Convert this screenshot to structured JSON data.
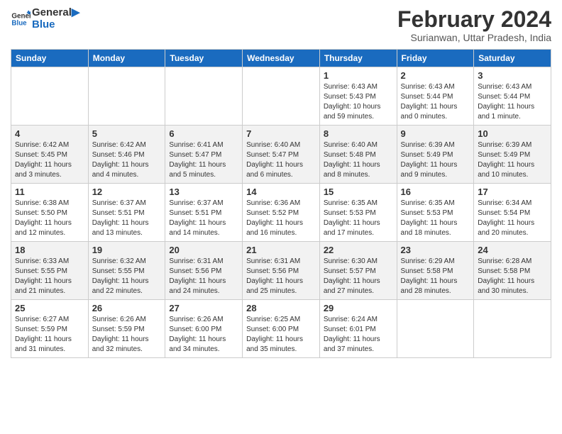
{
  "header": {
    "logo_line1": "General",
    "logo_line2": "Blue",
    "main_title": "February 2024",
    "subtitle": "Surianwan, Uttar Pradesh, India"
  },
  "columns": [
    "Sunday",
    "Monday",
    "Tuesday",
    "Wednesday",
    "Thursday",
    "Friday",
    "Saturday"
  ],
  "weeks": [
    [
      {
        "day": "",
        "info": ""
      },
      {
        "day": "",
        "info": ""
      },
      {
        "day": "",
        "info": ""
      },
      {
        "day": "",
        "info": ""
      },
      {
        "day": "1",
        "info": "Sunrise: 6:43 AM\nSunset: 5:43 PM\nDaylight: 10 hours and 59 minutes."
      },
      {
        "day": "2",
        "info": "Sunrise: 6:43 AM\nSunset: 5:44 PM\nDaylight: 11 hours and 0 minutes."
      },
      {
        "day": "3",
        "info": "Sunrise: 6:43 AM\nSunset: 5:44 PM\nDaylight: 11 hours and 1 minute."
      }
    ],
    [
      {
        "day": "4",
        "info": "Sunrise: 6:42 AM\nSunset: 5:45 PM\nDaylight: 11 hours and 3 minutes."
      },
      {
        "day": "5",
        "info": "Sunrise: 6:42 AM\nSunset: 5:46 PM\nDaylight: 11 hours and 4 minutes."
      },
      {
        "day": "6",
        "info": "Sunrise: 6:41 AM\nSunset: 5:47 PM\nDaylight: 11 hours and 5 minutes."
      },
      {
        "day": "7",
        "info": "Sunrise: 6:40 AM\nSunset: 5:47 PM\nDaylight: 11 hours and 6 minutes."
      },
      {
        "day": "8",
        "info": "Sunrise: 6:40 AM\nSunset: 5:48 PM\nDaylight: 11 hours and 8 minutes."
      },
      {
        "day": "9",
        "info": "Sunrise: 6:39 AM\nSunset: 5:49 PM\nDaylight: 11 hours and 9 minutes."
      },
      {
        "day": "10",
        "info": "Sunrise: 6:39 AM\nSunset: 5:49 PM\nDaylight: 11 hours and 10 minutes."
      }
    ],
    [
      {
        "day": "11",
        "info": "Sunrise: 6:38 AM\nSunset: 5:50 PM\nDaylight: 11 hours and 12 minutes."
      },
      {
        "day": "12",
        "info": "Sunrise: 6:37 AM\nSunset: 5:51 PM\nDaylight: 11 hours and 13 minutes."
      },
      {
        "day": "13",
        "info": "Sunrise: 6:37 AM\nSunset: 5:51 PM\nDaylight: 11 hours and 14 minutes."
      },
      {
        "day": "14",
        "info": "Sunrise: 6:36 AM\nSunset: 5:52 PM\nDaylight: 11 hours and 16 minutes."
      },
      {
        "day": "15",
        "info": "Sunrise: 6:35 AM\nSunset: 5:53 PM\nDaylight: 11 hours and 17 minutes."
      },
      {
        "day": "16",
        "info": "Sunrise: 6:35 AM\nSunset: 5:53 PM\nDaylight: 11 hours and 18 minutes."
      },
      {
        "day": "17",
        "info": "Sunrise: 6:34 AM\nSunset: 5:54 PM\nDaylight: 11 hours and 20 minutes."
      }
    ],
    [
      {
        "day": "18",
        "info": "Sunrise: 6:33 AM\nSunset: 5:55 PM\nDaylight: 11 hours and 21 minutes."
      },
      {
        "day": "19",
        "info": "Sunrise: 6:32 AM\nSunset: 5:55 PM\nDaylight: 11 hours and 22 minutes."
      },
      {
        "day": "20",
        "info": "Sunrise: 6:31 AM\nSunset: 5:56 PM\nDaylight: 11 hours and 24 minutes."
      },
      {
        "day": "21",
        "info": "Sunrise: 6:31 AM\nSunset: 5:56 PM\nDaylight: 11 hours and 25 minutes."
      },
      {
        "day": "22",
        "info": "Sunrise: 6:30 AM\nSunset: 5:57 PM\nDaylight: 11 hours and 27 minutes."
      },
      {
        "day": "23",
        "info": "Sunrise: 6:29 AM\nSunset: 5:58 PM\nDaylight: 11 hours and 28 minutes."
      },
      {
        "day": "24",
        "info": "Sunrise: 6:28 AM\nSunset: 5:58 PM\nDaylight: 11 hours and 30 minutes."
      }
    ],
    [
      {
        "day": "25",
        "info": "Sunrise: 6:27 AM\nSunset: 5:59 PM\nDaylight: 11 hours and 31 minutes."
      },
      {
        "day": "26",
        "info": "Sunrise: 6:26 AM\nSunset: 5:59 PM\nDaylight: 11 hours and 32 minutes."
      },
      {
        "day": "27",
        "info": "Sunrise: 6:26 AM\nSunset: 6:00 PM\nDaylight: 11 hours and 34 minutes."
      },
      {
        "day": "28",
        "info": "Sunrise: 6:25 AM\nSunset: 6:00 PM\nDaylight: 11 hours and 35 minutes."
      },
      {
        "day": "29",
        "info": "Sunrise: 6:24 AM\nSunset: 6:01 PM\nDaylight: 11 hours and 37 minutes."
      },
      {
        "day": "",
        "info": ""
      },
      {
        "day": "",
        "info": ""
      }
    ]
  ]
}
